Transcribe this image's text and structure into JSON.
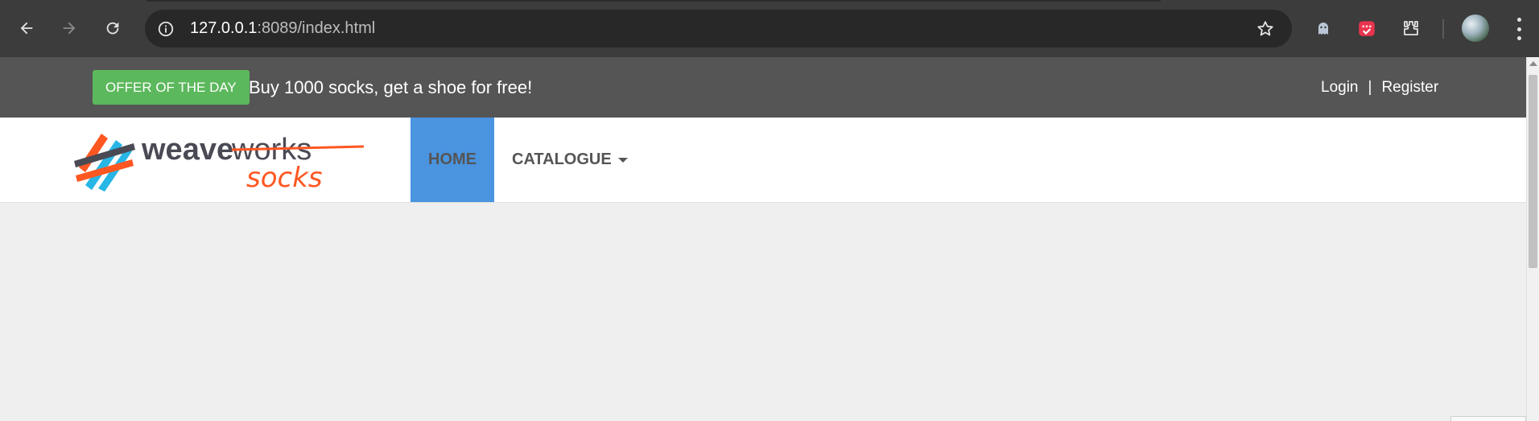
{
  "browser": {
    "url_host": "127.0.0.1",
    "url_rest": ":8089/index.html",
    "icons": {
      "back": "arrow-left-icon",
      "forward": "arrow-right-icon",
      "reload": "reload-icon",
      "site_info": "info-icon",
      "bookmark": "star-icon",
      "extension_1": "ghost-extension-icon",
      "extension_2": "calendar-extension-icon",
      "extensions": "puzzle-icon",
      "profile": "avatar-icon",
      "menu": "kebab-menu-icon"
    }
  },
  "topbar": {
    "offer_badge": "OFFER OF THE DAY",
    "offer_text": "Buy 1000 socks, get a shoe for free!",
    "login": "Login",
    "separator": "|",
    "register": "Register"
  },
  "navbar": {
    "logo_word_1": "weave",
    "logo_word_2": "works",
    "logo_word_3": "socks",
    "items": [
      {
        "label": "HOME",
        "active": true
      },
      {
        "label": "CATALOGUE",
        "dropdown": true
      }
    ]
  },
  "colors": {
    "offer_badge": "#5cb85c",
    "topbar_bg": "#555555",
    "active_nav": "#4a94e0",
    "logo_orange": "#ff5722",
    "logo_blue": "#27b6e6",
    "logo_dark": "#4a4a55",
    "page_bg": "#efefef"
  }
}
